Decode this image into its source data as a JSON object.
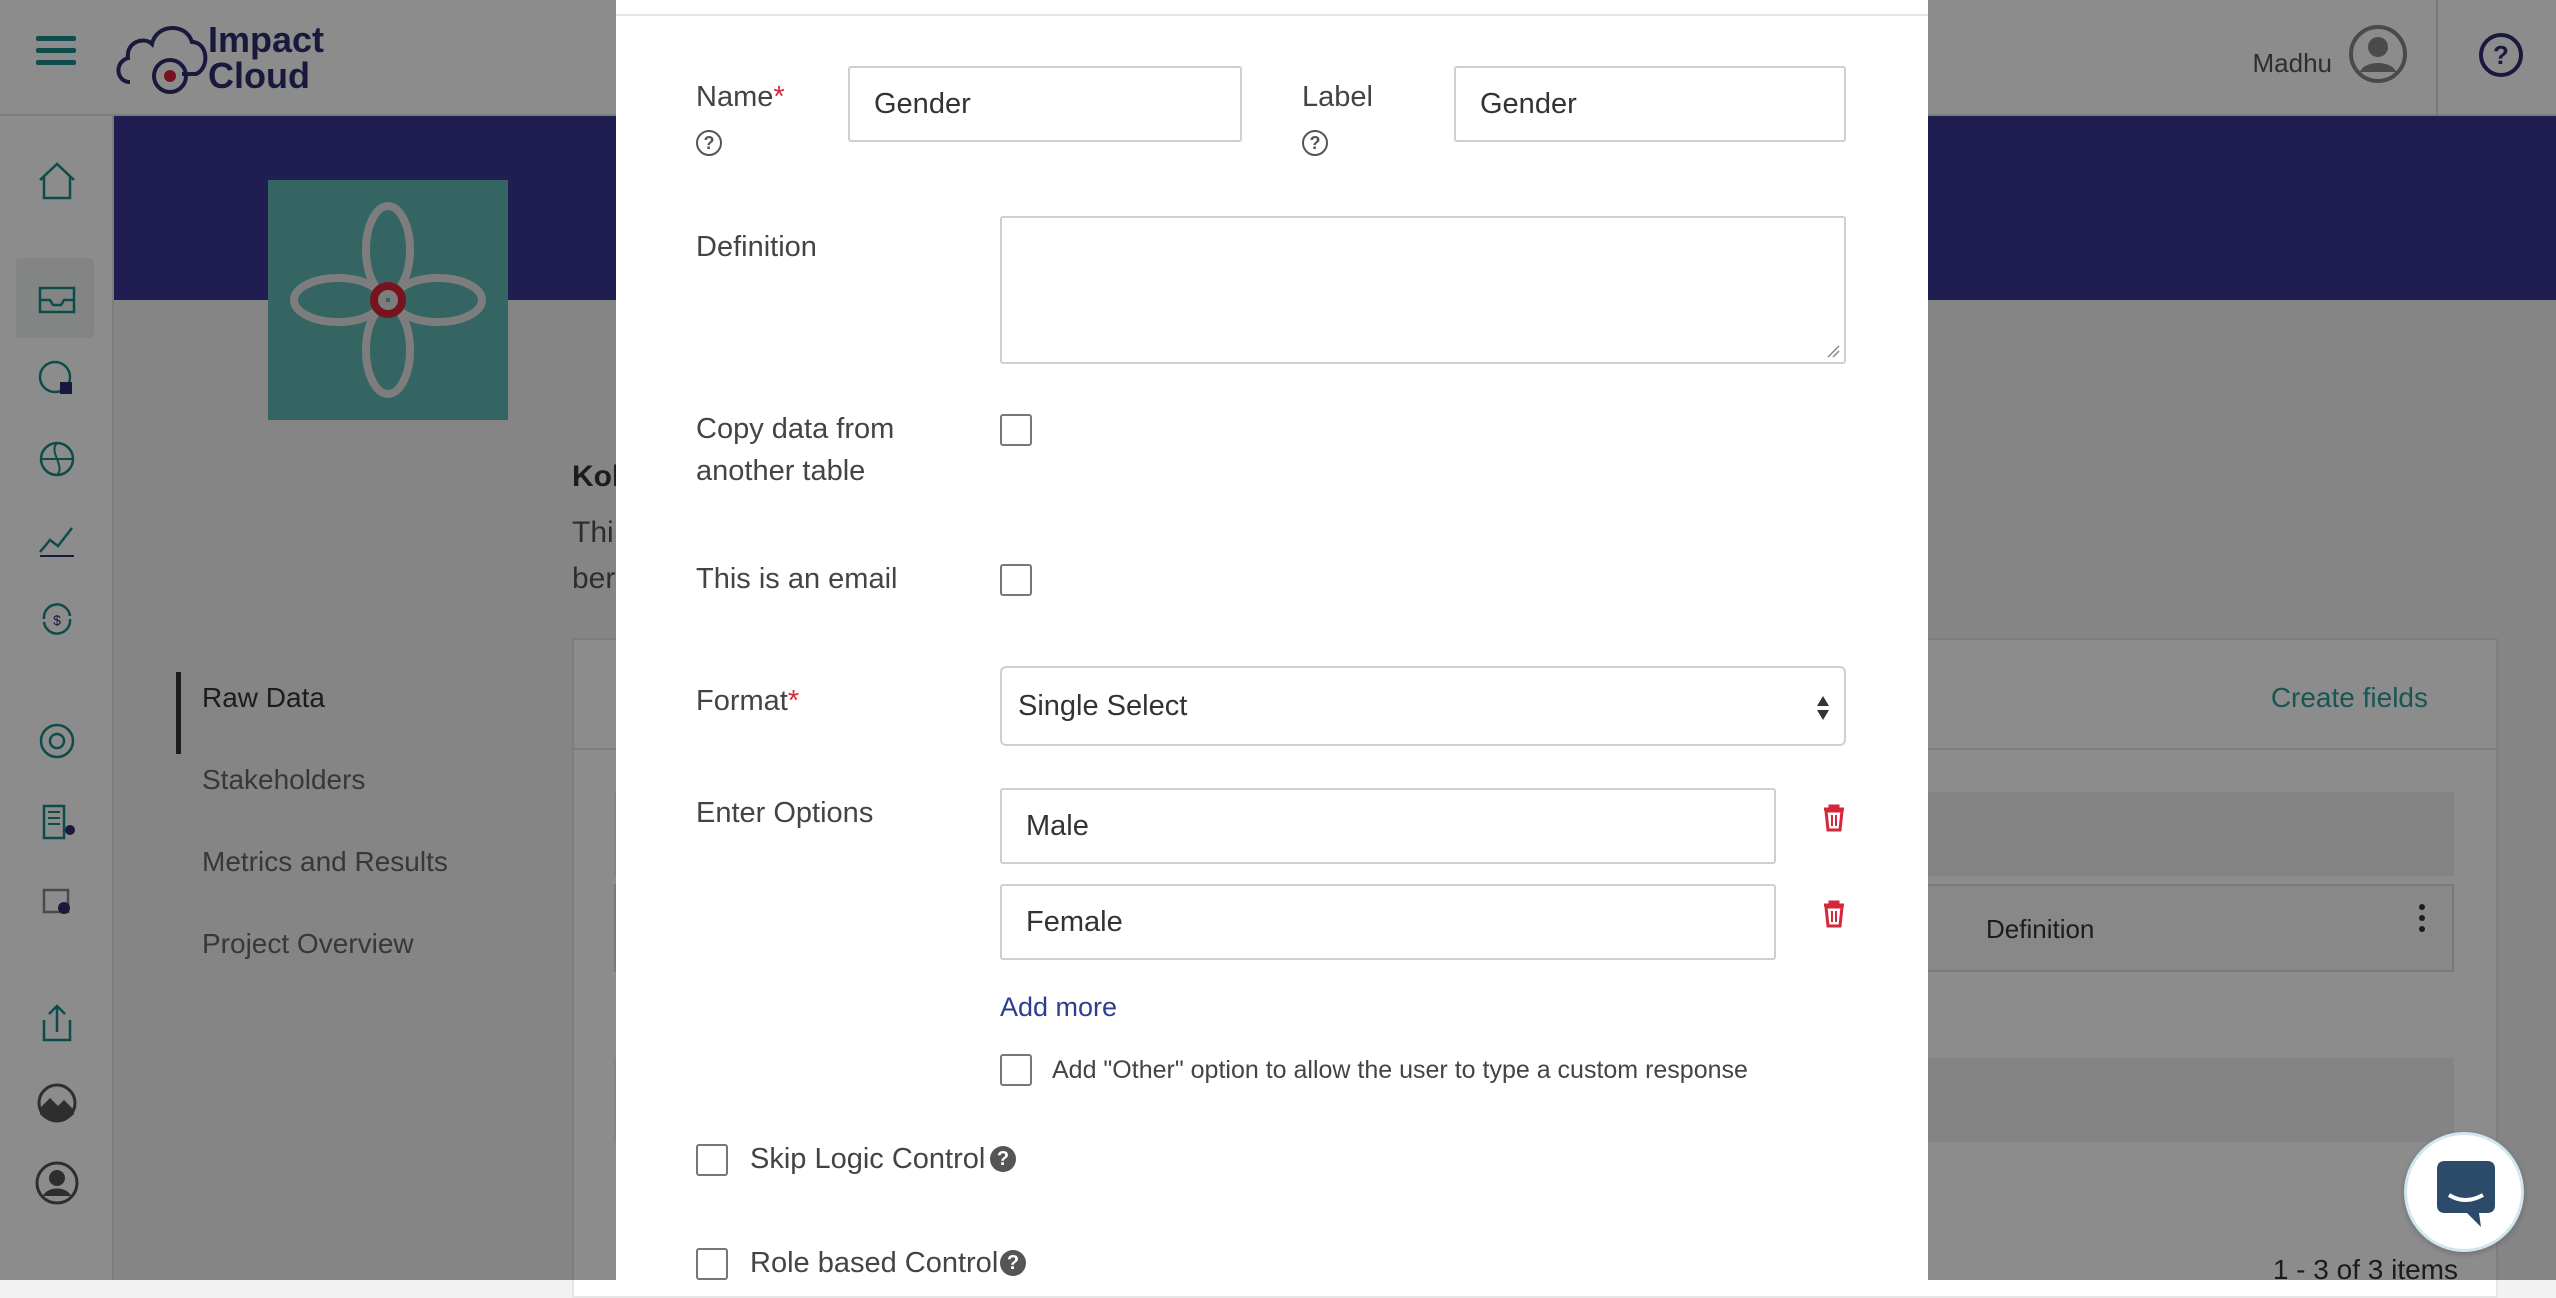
{
  "header": {
    "app_name_line1": "Impact",
    "app_name_line2": "Cloud",
    "username": "Madhu"
  },
  "sidebar": {
    "icons": [
      "home-icon",
      "inbox-icon",
      "globe-data-icon",
      "globe-icon",
      "trend-chart-icon",
      "dollar-cycle-icon",
      "lifebuoy-icon",
      "building-icon",
      "photo-id-icon",
      "upload-icon",
      "landscape-icon",
      "user-circle-icon"
    ]
  },
  "background": {
    "project_title": "Kol",
    "desc_line1": "Thi",
    "desc_line2": "ber",
    "nav": [
      "Raw Data",
      "Stakeholders",
      "Metrics and Results",
      "Project Overview"
    ],
    "create_fields": "Create fields",
    "definition": "Definition",
    "pager": "1 - 3 of 3 items",
    "banner_color": "#3a3596",
    "logo_color": "#5fb8b4"
  },
  "modal": {
    "name_label": "Name",
    "name_value": "Gender",
    "label_label": "Label",
    "label_value": "Gender",
    "definition_label": "Definition",
    "copy_label_line1": "Copy data from",
    "copy_label_line2": "another table",
    "email_label": "This is an email",
    "format_label": "Format",
    "format_value": "Single Select",
    "options_label": "Enter Options",
    "options": [
      "Male",
      "Female"
    ],
    "add_more": "Add more",
    "other_option": "Add \"Other\" option to allow the user to type a custom response",
    "skip_logic": "Skip Logic Control",
    "role_based": "Role based Control",
    "required_mark": "*",
    "help_glyph": "?",
    "required_color": "#d6263a"
  }
}
